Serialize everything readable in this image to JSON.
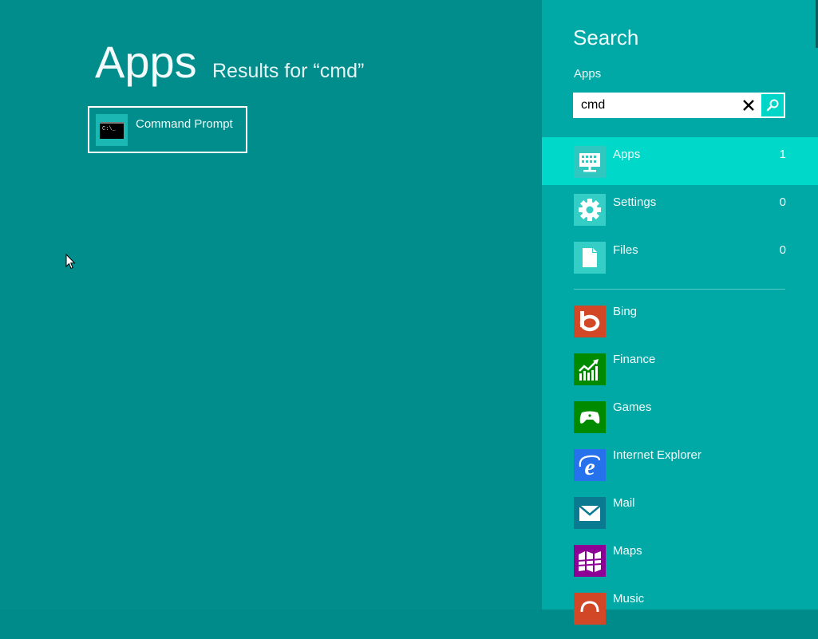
{
  "main": {
    "title": "Apps",
    "results_for": "Results for “cmd”",
    "results": [
      {
        "label": "Command Prompt",
        "icon": "command-prompt-icon",
        "icon_text": "C:\\_"
      }
    ]
  },
  "search_pane": {
    "title": "Search",
    "scope": "Apps",
    "query": "cmd",
    "clear_glyph": "✕",
    "categories": [
      {
        "label": "Apps",
        "count": "1",
        "icon": "apps-icon",
        "active": true
      },
      {
        "label": "Settings",
        "count": "0",
        "icon": "gear-icon",
        "active": false
      },
      {
        "label": "Files",
        "count": "0",
        "icon": "file-icon",
        "active": false
      }
    ],
    "apps": [
      {
        "label": "Bing",
        "icon": "bing-icon",
        "color": "#d24726"
      },
      {
        "label": "Finance",
        "icon": "finance-icon",
        "color": "#008a00"
      },
      {
        "label": "Games",
        "icon": "games-icon",
        "color": "#008a00"
      },
      {
        "label": "Internet Explorer",
        "icon": "internet-explorer-icon",
        "color": "#2672ec"
      },
      {
        "label": "Mail",
        "icon": "mail-icon",
        "color": "#0a7a91"
      },
      {
        "label": "Maps",
        "icon": "maps-icon",
        "color": "#8c0095"
      },
      {
        "label": "Music",
        "icon": "music-icon",
        "color": "#d24726"
      }
    ]
  },
  "colors": {
    "background": "#018d8b",
    "pane": "#00a8a6",
    "active_category": "#00d8ca"
  }
}
